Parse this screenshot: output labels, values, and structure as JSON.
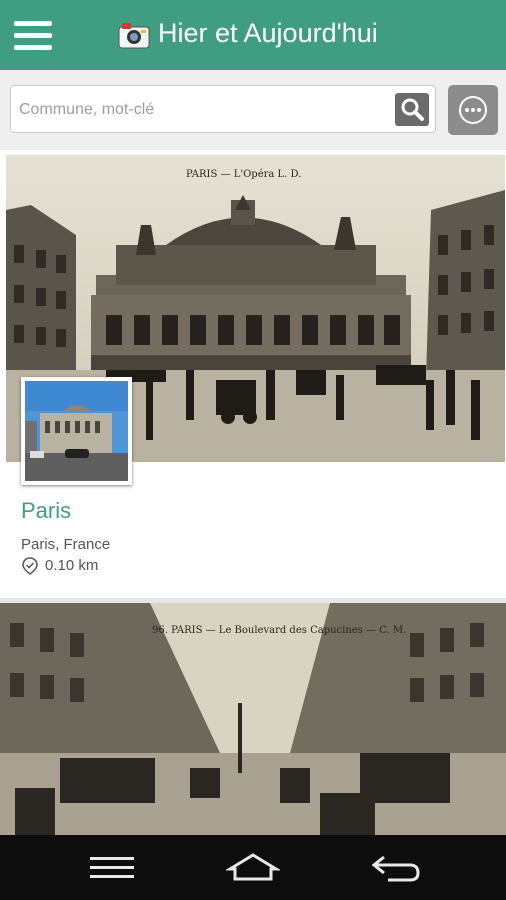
{
  "app": {
    "title": "Hier et Aujourd'hui"
  },
  "search": {
    "placeholder": "Commune, mot-clé",
    "value": ""
  },
  "cards": [
    {
      "photo_caption": "PARIS — L'Opéra  L. D.",
      "name": "Paris",
      "location": "Paris, France",
      "distance": "0.10 km"
    },
    {
      "photo_caption": "96. PARIS — Le Boulevard des Capucines — C. M."
    }
  ],
  "colors": {
    "accent": "#3f9d82",
    "navbar": "#0d0d0d"
  },
  "icons": [
    "menu-icon",
    "camera-logo",
    "search-icon",
    "more-icon",
    "location-check-icon",
    "nav-menu-icon",
    "nav-home-icon",
    "nav-back-icon"
  ]
}
